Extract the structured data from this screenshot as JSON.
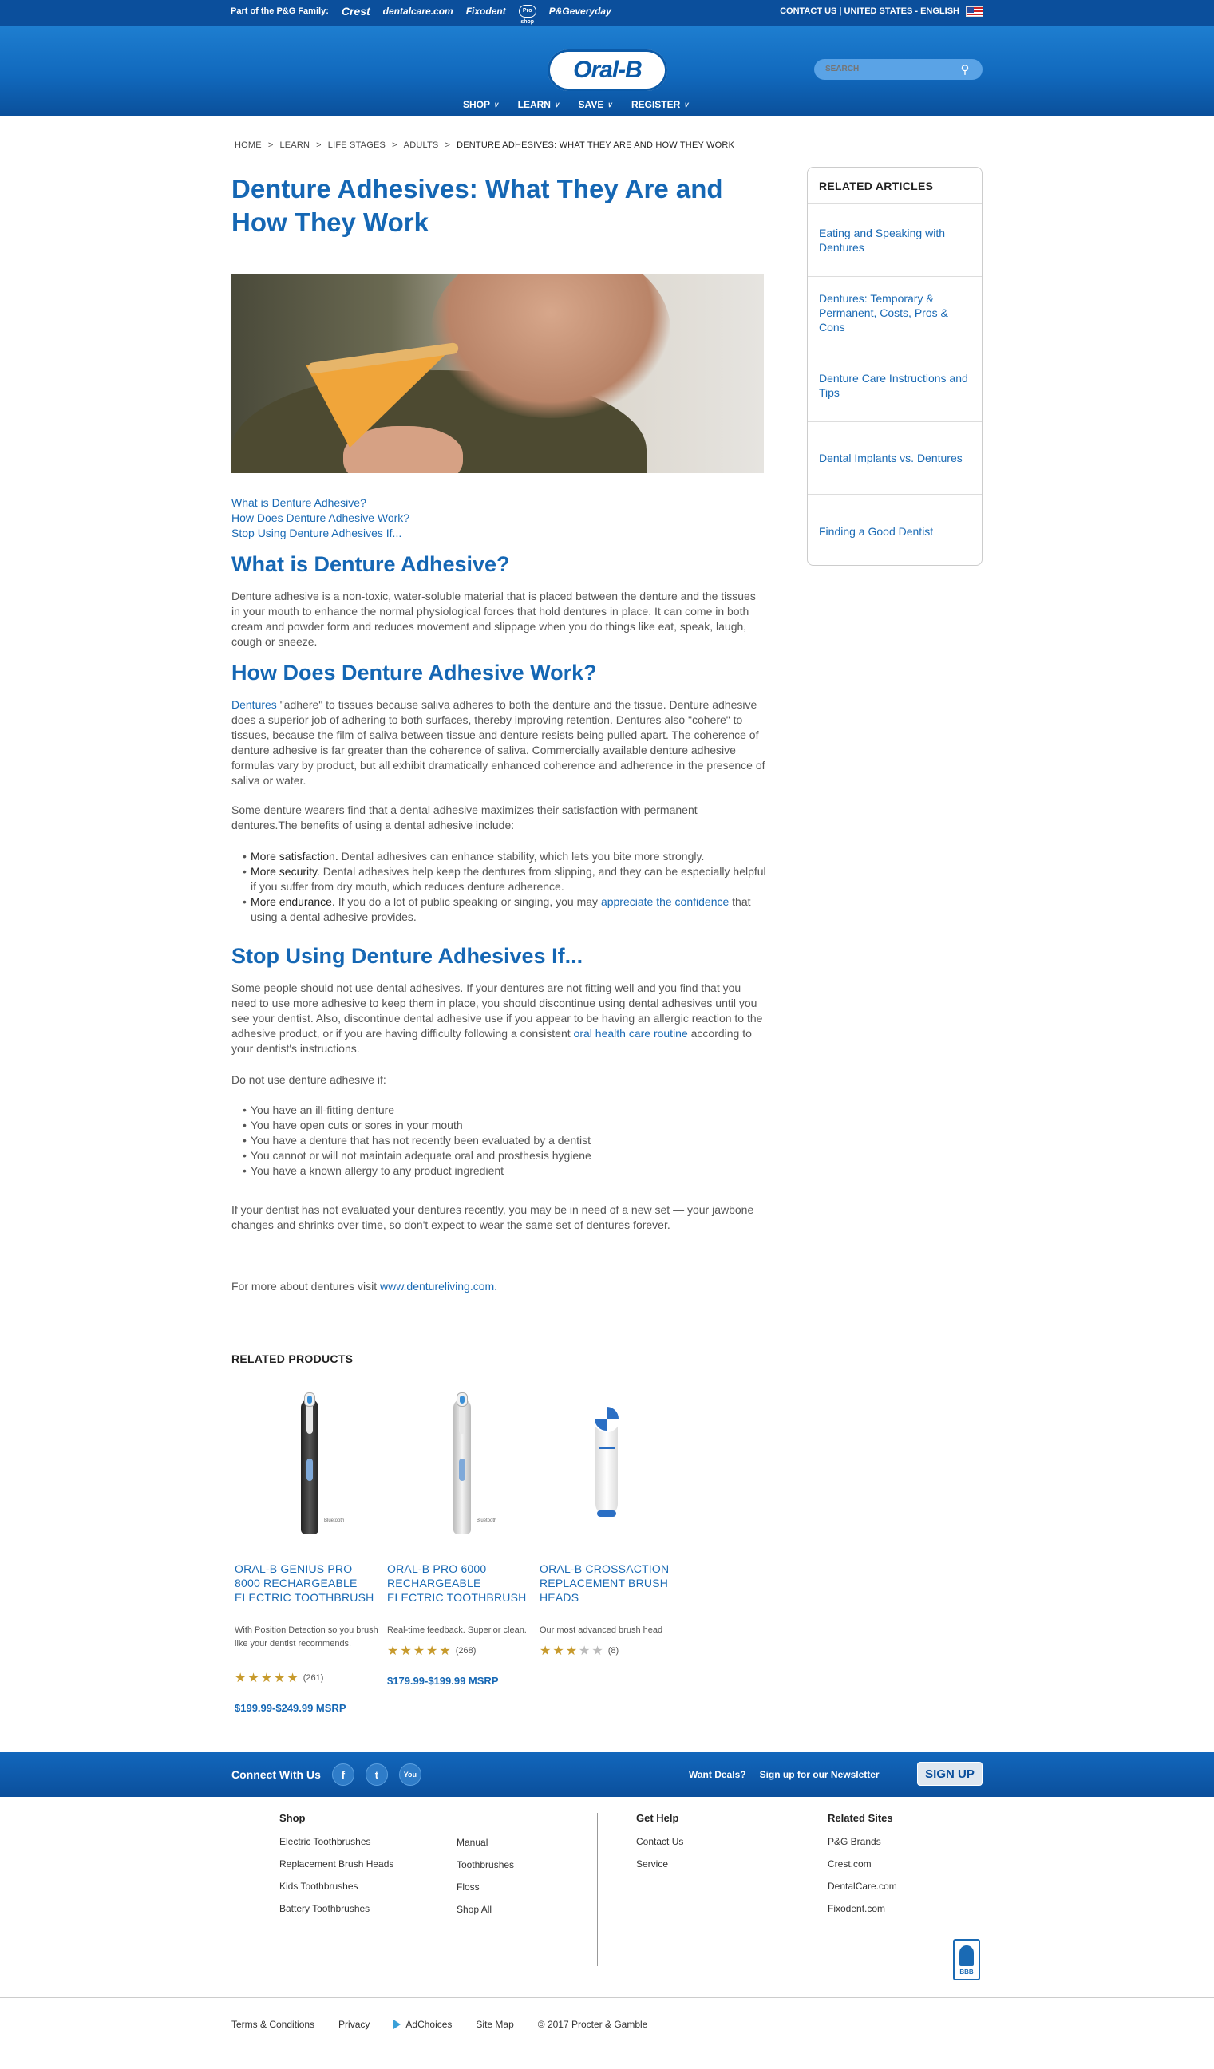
{
  "topbar": {
    "family_label": "Part of the P&G Family:",
    "brands": [
      "Crest",
      "dentalcare.com",
      "Fixodent",
      "Pro shop",
      "P&Geveryday"
    ],
    "right_text": "CONTACT US | UNITED STATES - ENGLISH"
  },
  "header": {
    "logo": "Oral-B",
    "search_placeholder": "SEARCH",
    "nav": [
      "SHOP",
      "LEARN",
      "SAVE",
      "REGISTER"
    ]
  },
  "breadcrumb": [
    "HOME",
    "LEARN",
    "LIFE STAGES",
    "ADULTS",
    "DENTURE ADHESIVES: WHAT THEY ARE AND HOW THEY WORK"
  ],
  "article": {
    "title": "Denture Adhesives: What They Are and How They Work",
    "toc": [
      "What is Denture Adhesive?",
      "How Does Denture Adhesive Work?",
      "Stop Using Denture Adhesives If..."
    ],
    "s1": {
      "heading": "What is Denture Adhesive?",
      "body": "Denture adhesive is a non-toxic, water-soluble material that is placed between the denture and the tissues in your mouth to enhance the normal physiological forces that hold dentures in place. It can come in both cream and powder form and reduces movement and slippage when you do things like eat, speak, laugh, cough or sneeze."
    },
    "s2": {
      "heading": "How Does Denture Adhesive Work?",
      "link": "Dentures",
      "body": " \"adhere\" to tissues because saliva adheres to both the denture and the tissue. Denture adhesive does a superior job of adhering to both surfaces, thereby improving retention. Dentures also \"cohere\" to tissues, because the film of saliva between tissue and denture resists being pulled apart. The coherence of denture adhesive is far greater than the coherence of saliva. Commercially available denture adhesive formulas vary by product, but all exhibit dramatically enhanced coherence and adherence in the presence of saliva or water.",
      "body2": "Some denture wearers find that a dental adhesive maximizes their satisfaction with permanent dentures.The benefits of using a dental adhesive include:",
      "benefits": [
        {
          "lead": "More satisfaction.",
          "text": " Dental adhesives can enhance stability, which lets you bite more strongly."
        },
        {
          "lead": "More security.",
          "text": " Dental adhesives help keep the dentures from slipping, and they can be especially helpful if you suffer from dry mouth, which reduces denture adherence."
        },
        {
          "lead": "More endurance.",
          "text": " If you do a lot of public speaking or singing, you may ",
          "link": "appreciate the confidence",
          "tail": " that using a dental adhesive provides."
        }
      ]
    },
    "s3": {
      "heading": "Stop Using Denture Adhesives If...",
      "body_a": "Some people should not use dental adhesives. If your dentures are not fitting well and you find that you need to use more adhesive to keep them in place, you should discontinue using dental adhesives until you see your dentist. Also, discontinue dental adhesive use if you appear to be having an allergic reaction to the adhesive product, or if you are having difficulty following a consistent ",
      "link": "oral health care routine",
      "body_b": " according to your dentist's instructions.",
      "intro": "Do not use denture adhesive if:",
      "items": [
        "You have an ill-fitting denture",
        "You have open cuts or sores in your mouth",
        "You have a denture that has not recently been evaluated by a dentist",
        "You cannot or will not maintain adequate oral and prosthesis hygiene",
        "You have a known allergy to any product ingredient"
      ],
      "closing": "If your dentist has not evaluated your dentures recently, you may be in need of a new set — your jawbone changes and shrinks over time, so don't expect to wear the same set of dentures forever.",
      "more_prefix": "For more about dentures visit ",
      "more_link": "www.dentureliving.com."
    }
  },
  "related_articles": {
    "title": "RELATED ARTICLES",
    "items": [
      "Eating and Speaking with Dentures",
      "Dentures: Temporary & Permanent, Costs, Pros & Cons",
      "Denture Care Instructions and Tips",
      "Dental Implants vs. Dentures",
      "Finding a Good Dentist"
    ]
  },
  "related_products": {
    "title": "RELATED PRODUCTS",
    "items": [
      {
        "name": "ORAL-B GENIUS PRO 8000 RECHARGEABLE ELECTRIC TOOTHBRUSH",
        "desc": "With Position Detection so you brush like your dentist recommends.",
        "rating": 5,
        "reviews": "(261)",
        "price": "$199.99-$249.99 MSRP",
        "image_label": "Bluetooth"
      },
      {
        "name": "ORAL-B PRO 6000 RECHARGEABLE ELECTRIC TOOTHBRUSH",
        "desc": "Real-time feedback. Superior clean.",
        "rating": 5,
        "reviews": "(268)",
        "price": "$179.99-$199.99 MSRP",
        "image_label": "Bluetooth"
      },
      {
        "name": "ORAL-B CROSSACTION REPLACEMENT BRUSH HEADS",
        "desc": "Our most advanced brush head",
        "rating": 3.5,
        "reviews": "(8)",
        "price": ""
      }
    ]
  },
  "footer": {
    "connect": "Connect With Us",
    "social": [
      "f",
      "t",
      "You"
    ],
    "deals": "Want Deals?",
    "newsletter": "Sign up for our Newsletter",
    "signup": "SIGN UP",
    "shop_title": "Shop",
    "shop_col1": [
      "Electric Toothbrushes",
      "Replacement Brush Heads",
      "Kids Toothbrushes",
      "Battery Toothbrushes"
    ],
    "shop_col2": [
      "Manual",
      "Toothbrushes",
      "Floss",
      "Shop All"
    ],
    "help_title": "Get Help",
    "help": [
      "Contact Us",
      "Service"
    ],
    "sites_title": "Related Sites",
    "sites": [
      "P&G Brands",
      "Crest.com",
      "DentalCare.com",
      "Fixodent.com"
    ],
    "bbb": "BBB",
    "legal": [
      "Terms & Conditions",
      "Privacy",
      "AdChoices",
      "Site Map"
    ],
    "copyright": "© 2017 Procter & Gamble"
  },
  "colors": {
    "brand_blue": "#0b4f9c",
    "link_blue": "#1a6ab4",
    "heading_blue": "#1567b4",
    "star_gold": "#c79a2c"
  }
}
